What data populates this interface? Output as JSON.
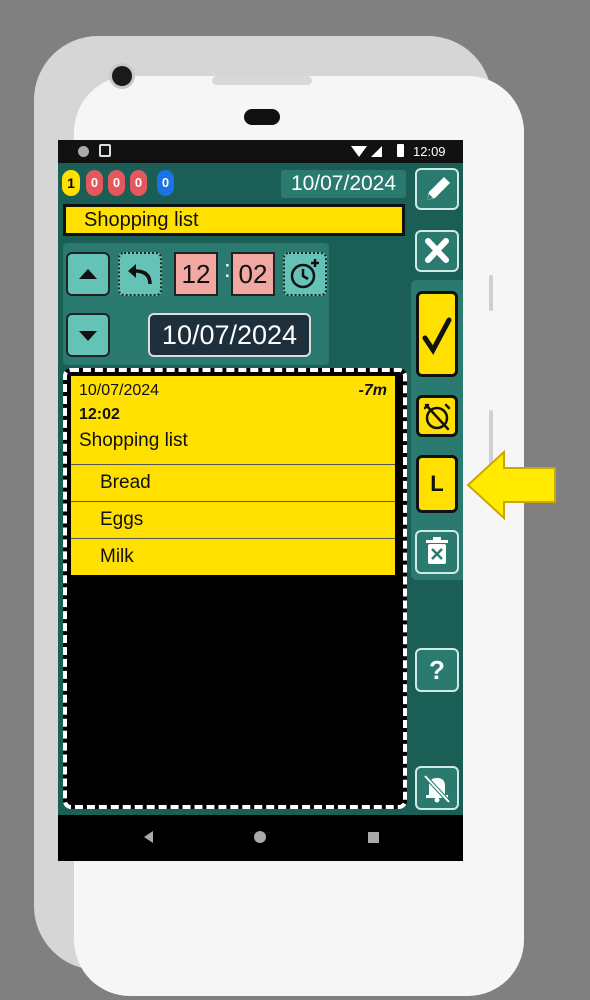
{
  "status_bar": {
    "time": "12:09"
  },
  "counters": [
    {
      "value": "1",
      "color": "#ffe000"
    },
    {
      "value": "0",
      "color": "#e4575c"
    },
    {
      "value": "0",
      "color": "#e4575c"
    },
    {
      "value": "0",
      "color": "#e4575c"
    },
    {
      "value": "0",
      "color": "#1a73e8"
    }
  ],
  "header": {
    "date": "10/07/2024",
    "title": "Shopping list"
  },
  "time_editor": {
    "hour": "12",
    "separator": ":",
    "minute": "02",
    "date": "10/07/2024"
  },
  "note": {
    "date": "10/07/2024",
    "relative": "-7m",
    "time": "12:02",
    "title": "Shopping list",
    "items": [
      "Bread",
      "Eggs",
      "Milk"
    ]
  },
  "side_buttons": {
    "edit": "pencil-icon",
    "close": "close-icon",
    "confirm": "check-icon",
    "alarm_off": "alarm-off-icon",
    "list_label": "L",
    "delete": "trash-icon",
    "help_label": "?",
    "mute": "bell-off-icon"
  },
  "colors": {
    "accent": "#ffe000",
    "background": "#1b5e55",
    "panel": "#2b7a6f"
  }
}
